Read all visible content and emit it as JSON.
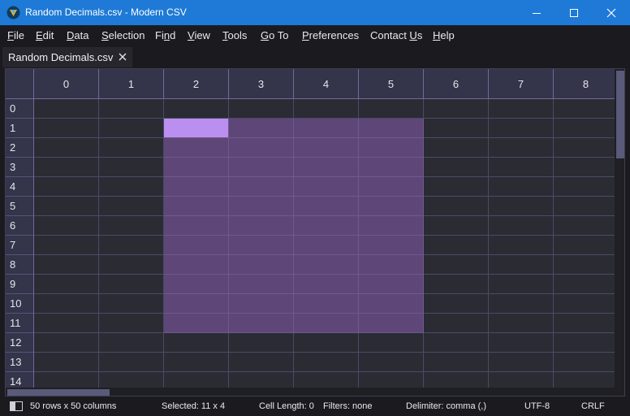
{
  "window": {
    "title": "Random Decimals.csv - Modern CSV",
    "app_icon": "modern-csv-logo",
    "titlebar_color": "#1e7ad6"
  },
  "menu": [
    {
      "pre": "",
      "u": "F",
      "post": "ile"
    },
    {
      "pre": "",
      "u": "E",
      "post": "dit"
    },
    {
      "pre": "",
      "u": "D",
      "post": "ata"
    },
    {
      "pre": "",
      "u": "S",
      "post": "election"
    },
    {
      "pre": "Fi",
      "u": "n",
      "post": "d"
    },
    {
      "pre": "",
      "u": "V",
      "post": "iew"
    },
    {
      "pre": "",
      "u": "T",
      "post": "ools"
    },
    {
      "pre": "",
      "u": "G",
      "post": "o To"
    },
    {
      "pre": "",
      "u": "P",
      "post": "references"
    },
    {
      "pre": "Contact ",
      "u": "U",
      "post": "s"
    },
    {
      "pre": "",
      "u": "H",
      "post": "elp"
    }
  ],
  "tab": {
    "label": "Random Decimals.csv",
    "close_icon": "close-icon"
  },
  "grid": {
    "columns": [
      "0",
      "1",
      "2",
      "3",
      "4",
      "5",
      "6",
      "7",
      "8"
    ],
    "rows": [
      "0",
      "1",
      "2",
      "3",
      "4",
      "5",
      "6",
      "7",
      "8",
      "9",
      "10",
      "11",
      "12",
      "13",
      "14"
    ],
    "selection": {
      "row_start": 1,
      "row_end": 11,
      "col_start": 2,
      "col_end": 5
    },
    "current_cell": {
      "row": 1,
      "col": 2
    },
    "selection_color": "#5e4678",
    "current_cell_color": "#bb8fef"
  },
  "status": {
    "size": "50 rows x 50 columns",
    "selected": "Selected: 11 x 4",
    "cell_length": "Cell Length: 0",
    "filters": "Filters: none",
    "delimiter": "Delimiter: comma (,)",
    "encoding": "UTF-8",
    "line_ending": "CRLF"
  }
}
